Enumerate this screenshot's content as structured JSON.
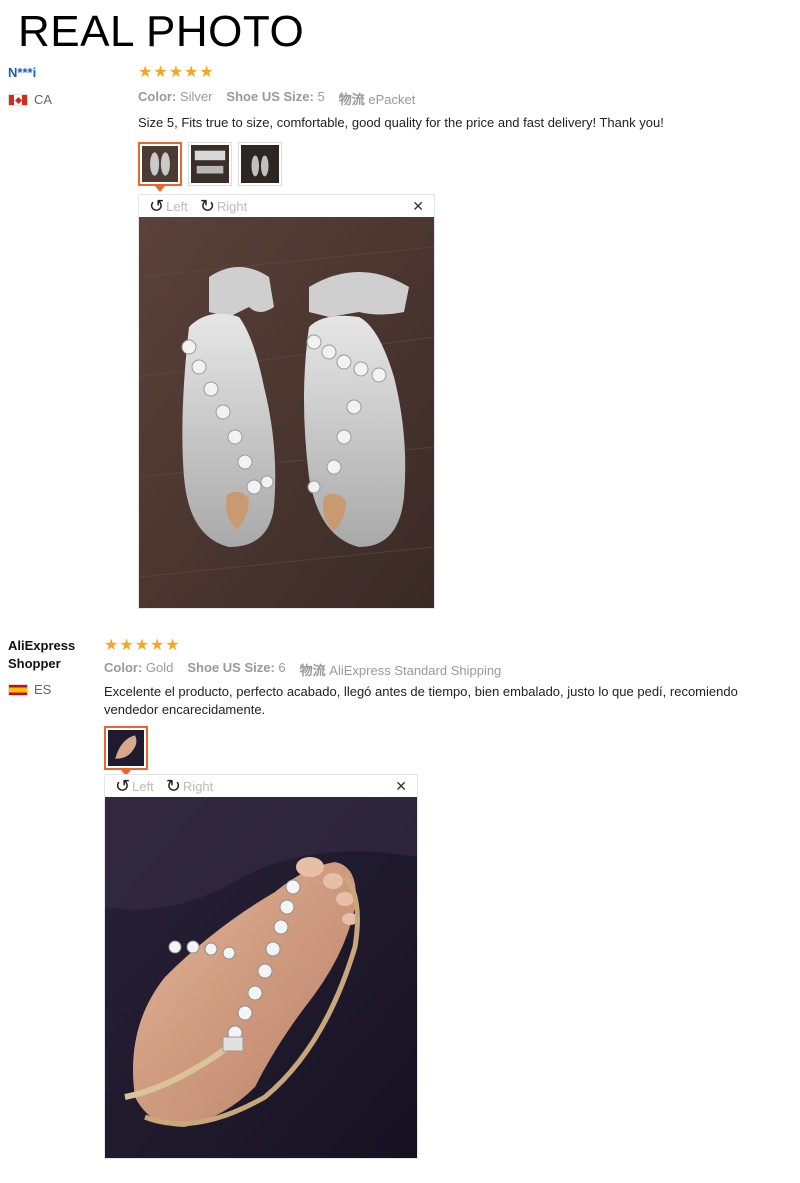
{
  "page_title": "REAL PHOTO",
  "reviews": [
    {
      "reviewer": "N***i",
      "country": "CA",
      "rating": 5,
      "attributes": [
        {
          "key": "Color:",
          "value": "Silver"
        },
        {
          "key": "Shoe US Size:",
          "value": "5"
        },
        {
          "key": "物流",
          "value": "ePacket"
        }
      ],
      "text": "Size 5, Fits true to size, comfortable, good quality for the price and fast delivery! Thank you!",
      "rotate_left": "Left",
      "rotate_right": "Right"
    },
    {
      "reviewer": "AliExpress Shopper",
      "country": "ES",
      "rating": 5,
      "attributes": [
        {
          "key": "Color:",
          "value": "Gold"
        },
        {
          "key": "Shoe US Size:",
          "value": "6"
        },
        {
          "key": "物流",
          "value": "AliExpress Standard Shipping"
        }
      ],
      "text": "Excelente el producto, perfecto acabado, llegó antes de tiempo, bien embalado, justo lo que pedí, recomiendo vendedor encarecidamente.",
      "rotate_left": "Left",
      "rotate_right": "Right"
    }
  ],
  "icons": {
    "star": "star-icon",
    "rotate_left": "rotate-left-icon",
    "rotate_right": "rotate-right-icon",
    "close": "close-icon"
  },
  "colors": {
    "star": "#f5a623",
    "active_thumb": "#e8662b",
    "reviewer_link": "#1a5cb8"
  }
}
